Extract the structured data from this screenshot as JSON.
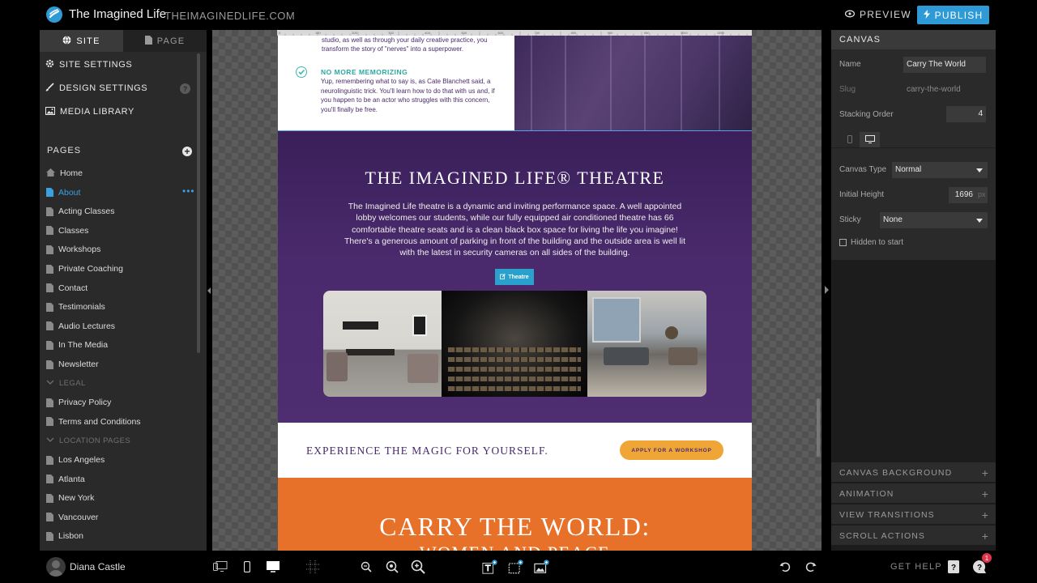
{
  "header": {
    "site_title": "The Imagined Life",
    "site_domain": "THEIMAGINEDLIFE.COM",
    "preview_label": "PREVIEW",
    "publish_label": "PUBLISH"
  },
  "left_panel": {
    "tabs": [
      {
        "label": "SITE",
        "icon": "globe-icon",
        "active": true
      },
      {
        "label": "PAGE",
        "icon": "document-icon",
        "active": false
      }
    ],
    "menu": [
      {
        "label": "SITE SETTINGS",
        "icon": "gear-icon"
      },
      {
        "label": "DESIGN SETTINGS",
        "icon": "brush-icon"
      },
      {
        "label": "MEDIA LIBRARY",
        "icon": "image-icon"
      }
    ],
    "help_glyph": "?",
    "pages_heading": "PAGES",
    "add_glyph": "+",
    "active_more": "•••",
    "pages": [
      {
        "label": "Home",
        "kind": "home"
      },
      {
        "label": "About",
        "kind": "page",
        "active": true
      },
      {
        "label": "Acting Classes",
        "kind": "page"
      },
      {
        "label": "Classes",
        "kind": "page"
      },
      {
        "label": "Workshops",
        "kind": "page"
      },
      {
        "label": "Private Coaching",
        "kind": "page"
      },
      {
        "label": "Contact",
        "kind": "page"
      },
      {
        "label": "Testimonials",
        "kind": "page"
      },
      {
        "label": "Audio Lectures",
        "kind": "page"
      },
      {
        "label": "In The Media",
        "kind": "page"
      },
      {
        "label": "Newsletter",
        "kind": "page"
      },
      {
        "label": "LEGAL",
        "kind": "section"
      },
      {
        "label": "Privacy Policy",
        "kind": "page"
      },
      {
        "label": "Terms and Conditions",
        "kind": "page"
      },
      {
        "label": "LOCATION PAGES",
        "kind": "section"
      },
      {
        "label": "Los Angeles",
        "kind": "page"
      },
      {
        "label": "Atlanta",
        "kind": "page"
      },
      {
        "label": "New York",
        "kind": "page"
      },
      {
        "label": "Vancouver",
        "kind": "page"
      },
      {
        "label": "Lisbon",
        "kind": "page"
      }
    ]
  },
  "canvas_page": {
    "ruler_ticks": [
      "0",
      "100",
      "200",
      "300",
      "400",
      "500",
      "600",
      "700",
      "800",
      "900",
      "950",
      "1000",
      "1550"
    ],
    "intro_text": "studio, as well as through your daily creative practice, you transform the story of \"nerves\" into a superpower.",
    "no_more_title": "NO MORE MEMORIZING",
    "no_more_body": "Yup, remembering what to say is, as Cate Blanchett said, a neurolinguistic trick. You'll learn how to do that with us and, if you happen to be an actor who struggles with this concern, you'll finally be free.",
    "theatre_title": "THE IMAGINED LIFE® THEATRE",
    "theatre_body": "The Imagined Life theatre is a dynamic and inviting performance space. A well appointed lobby welcomes our students, while our fully equipped air conditioned theatre has 66 comfortable theatre seats and is a clean black box space for living the life you imagine! There's a generous amount of parking in front of the building and the outside area is well lit with the latest in security cameras on all sides of the building.",
    "theatre_button": "Theatre",
    "magic_text": "EXPERIENCE THE MAGIC FOR YOURSELF.",
    "apply_button": "APPLY FOR A WORKSHOP",
    "carry_title": "CARRY THE WORLD:",
    "carry_subtitle": "WOMEN AND PEACE"
  },
  "right_panel": {
    "heading": "CANVAS",
    "name_label": "Name",
    "name_value": "Carry The World",
    "slug_label": "Slug",
    "slug_value": "carry-the-world",
    "stacking_label": "Stacking Order",
    "stacking_value": "4",
    "canvas_type_label": "Canvas Type",
    "canvas_type_value": "Normal",
    "initial_height_label": "Initial Height",
    "initial_height_value": "1696",
    "initial_height_unit": "px",
    "sticky_label": "Sticky",
    "sticky_value": "None",
    "hidden_label": "Hidden to start",
    "hidden_checked": false,
    "sections": [
      "CANVAS BACKGROUND",
      "ANIMATION",
      "VIEW TRANSITIONS",
      "SCROLL ACTIONS"
    ],
    "section_plus": "+"
  },
  "bottom_bar": {
    "user_name": "Diana Castle",
    "get_help": "GET HELP",
    "notification_count": "1",
    "tools": [
      "multi-device-icon",
      "phone-icon",
      "desktop-icon",
      "grid-icon",
      "zoom-out-icon",
      "zoom-reset-icon",
      "zoom-in-icon",
      "add-text-icon",
      "add-box-icon",
      "add-image-icon",
      "undo-icon",
      "redo-icon",
      "help-book-icon",
      "chat-help-icon"
    ]
  },
  "colors": {
    "accent": "#2e9bd6",
    "purple": "#4a2a6c",
    "orange": "#e8712a",
    "teal": "#2fa7a0",
    "gold": "#f0a636",
    "notification": "#e0344a"
  }
}
